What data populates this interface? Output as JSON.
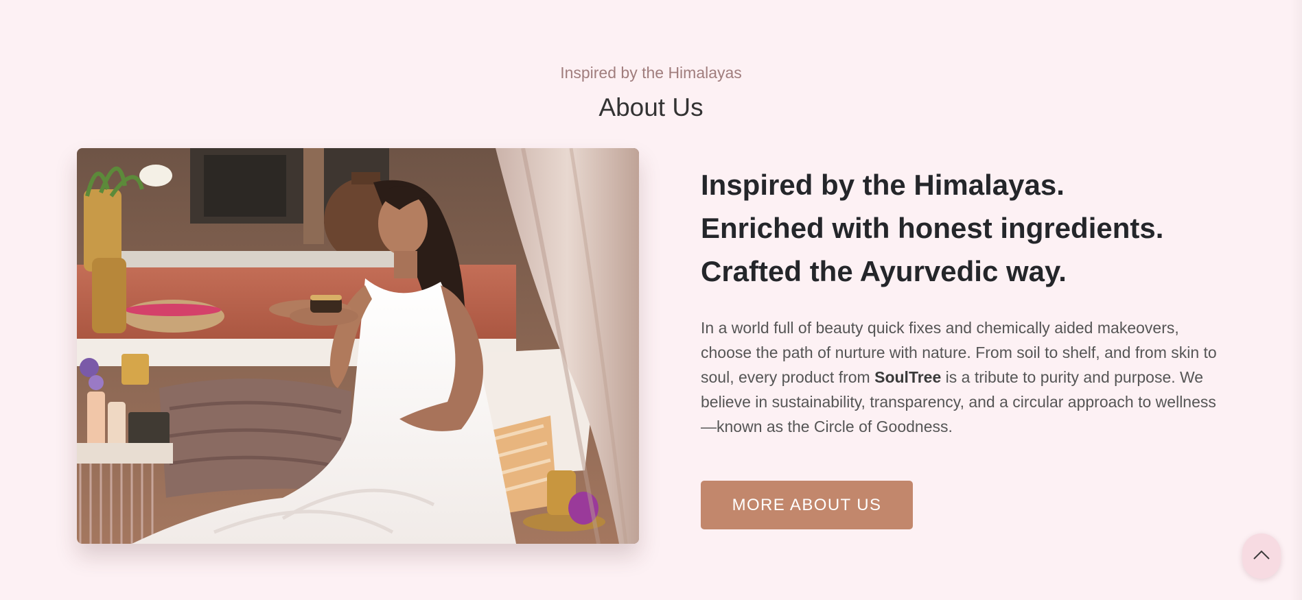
{
  "section": {
    "kicker": "Inspired by the Himalayas",
    "title": "About Us"
  },
  "content": {
    "headline_lines": [
      "Inspired by the Himalayas.",
      "Enriched with honest ingredients.",
      "Crafted the Ayurvedic way."
    ],
    "body_before_brand": "In a world full of beauty quick fixes and chemically aided makeovers, choose the path of nurture with nature. From soil to shelf, and from skin to soul, every product from ",
    "brand": "SoulTree",
    "body_after_brand": " is a tribute to purity and purpose. We believe in sustainability, transparency, and a circular approach to wellness—known as the Circle of Goodness.",
    "cta_label": "MORE ABOUT US"
  },
  "icons": {
    "back_to_top": "chevron-up-icon"
  },
  "colors": {
    "background": "#fdf1f4",
    "kicker": "#a07d7d",
    "heading": "#24262a",
    "body": "#555555",
    "button": "#c2876c",
    "button_text": "#ffffff",
    "back_to_top_bg": "#f7dbe2"
  }
}
